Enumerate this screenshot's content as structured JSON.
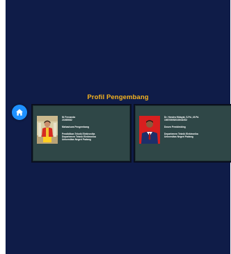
{
  "header": {
    "title": "Profil Pengembang",
    "home_icon": "home-icon"
  },
  "colors": {
    "background": "#0f1c48",
    "title": "#f5b320",
    "card": "#2f4747",
    "home_button": "#1e90ff"
  },
  "developers": [
    {
      "name": "Ni Fernanda",
      "id": "21065082",
      "role": "Mahasiswa Pengembang",
      "program": "Pendidikan Teknik Elektronika",
      "department": "Departemen Teknik Elektronika",
      "university": "Universitas Negeri Padang"
    },
    {
      "name": "Dr. Hendra Hidayat, S.Pd., M.Pd.",
      "id": "198705052015041002",
      "role": "Dosen Pembimbing",
      "department": "Departemen Teknik Elektronika",
      "university": "Universitas Negeri Padang"
    }
  ]
}
